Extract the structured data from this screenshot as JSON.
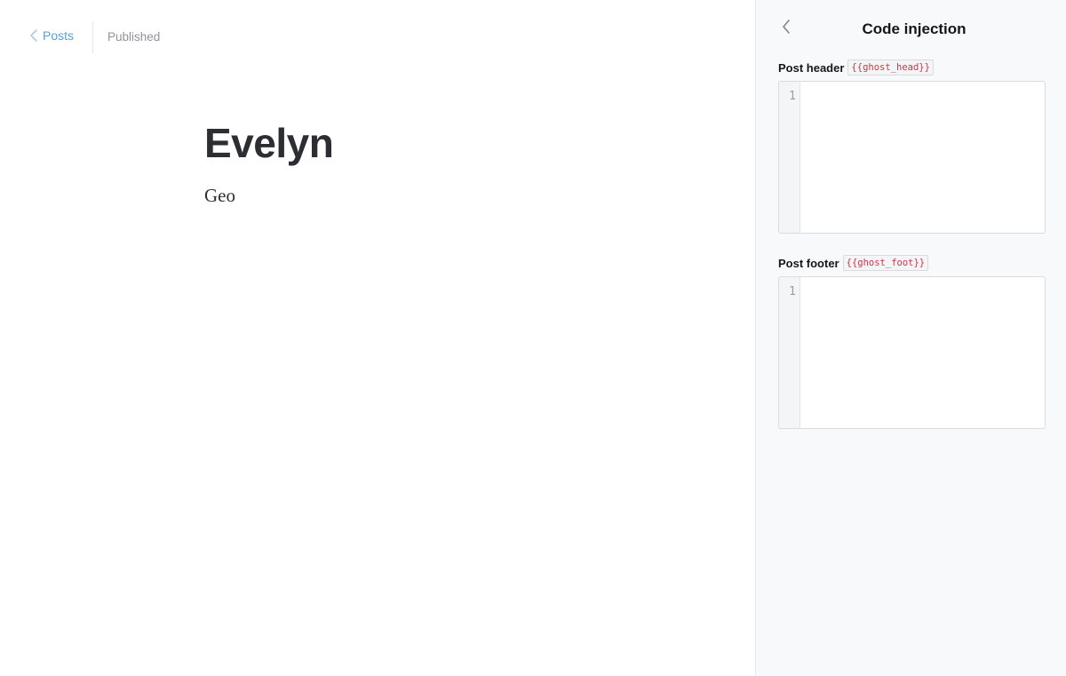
{
  "editor": {
    "back_label": "Posts",
    "status": "Published",
    "title": "Evelyn",
    "body": "Geo"
  },
  "panel": {
    "title": "Code injection",
    "header": {
      "label": "Post header",
      "tag": "{{ghost_head}}",
      "line_number": "1",
      "value": ""
    },
    "footer": {
      "label": "Post footer",
      "tag": "{{ghost_foot}}",
      "line_number": "1",
      "value": ""
    }
  },
  "colors": {
    "link": "#5aa0d8",
    "status": "#8e9399",
    "tag_text": "#d0334a",
    "panel_bg": "#f8f9fa"
  },
  "icons": {
    "back": "chevron-left-icon",
    "panel_back": "chevron-left-icon"
  }
}
